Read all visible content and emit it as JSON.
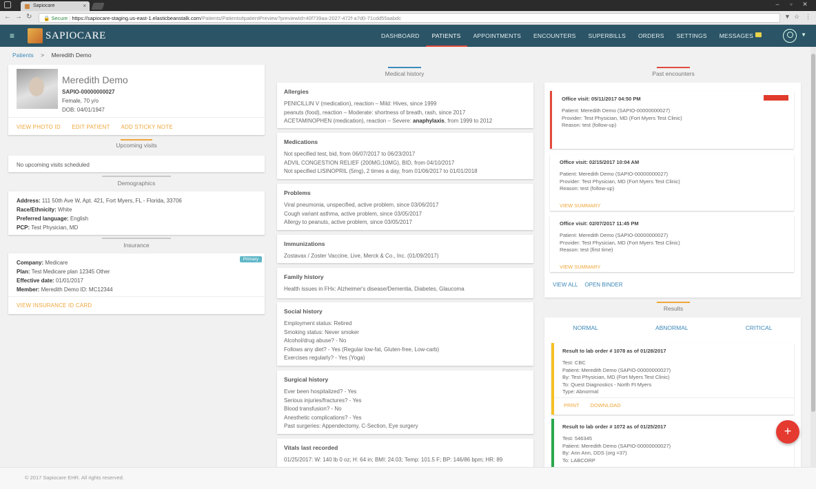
{
  "browser": {
    "tab_title": "Sapiocare",
    "secure_label": "Secure",
    "url_host": "https://sapiocare-staging.us-east-1.elasticbeanstalk.com",
    "url_path": "/Patients/Patients#patientPreview?previewId=40f739aa-2027-472f-a7d0-71cdd55aabdc"
  },
  "header": {
    "logo_text": "SAPIOCARE",
    "nav": [
      "DASHBOARD",
      "PATIENTS",
      "APPOINTMENTS",
      "ENCOUNTERS",
      "SUPERBILLS",
      "ORDERS",
      "SETTINGS",
      "MESSAGES"
    ],
    "active_nav": "PATIENTS"
  },
  "breadcrumb": {
    "root": "Patients",
    "separator": ">",
    "current": "Meredith Demo"
  },
  "patient": {
    "name": "Meredith Demo",
    "id": "SAPIO-00000000027",
    "sex_age": "Female, 70 y/o",
    "dob": "DOB: 04/01/1947",
    "actions": [
      "VIEW PHOTO ID",
      "EDIT PATIENT",
      "ADD STICKY NOTE"
    ]
  },
  "upcoming": {
    "title": "Upcoming visits",
    "empty": "No upcoming visits scheduled"
  },
  "demographics": {
    "title": "Demographics",
    "address_label": "Address:",
    "address": "111 50th Ave W, Apt. 421, Fort Myers, FL - Florida, 33706",
    "race_label": "Race/Ethnicity:",
    "race": "White",
    "language_label": "Preferred language:",
    "language": "English",
    "pcp_label": "PCP:",
    "pcp": "Test Physician, MD"
  },
  "insurance": {
    "title": "Insurance",
    "badge": "Primary",
    "company_label": "Company:",
    "company": "Medicare",
    "plan_label": "Plan:",
    "plan": "Test Medicare plan 12345 Other",
    "effective_label": "Effective date:",
    "effective": "01/01/2017",
    "member_label": "Member:",
    "member": "Meredith Demo ID: MC12344",
    "action": "VIEW INSURANCE ID CARD"
  },
  "medical_history": {
    "title": "Medical history",
    "sections": [
      {
        "title": "Allergies",
        "lines": [
          "PENICILLIN V (medication), reaction – Mild: Hives, since 1999",
          "peanuts (food), reaction – Moderate: shortness of breath, rash, since 2017",
          "ACETAMINOPHEN (medication), reaction – Severe: anaphylaxis, from 1999 to 2012"
        ]
      },
      {
        "title": "Medications",
        "lines": [
          "Not specified test, bid, from 06/07/2017 to 06/23/2017",
          "ADVIL CONGESTION RELIEF (200MG;10MG), BID, from 04/10/2017",
          "Not specified LISINOPRIL (5mg), 2 times a day, from 01/06/2017 to 01/01/2018"
        ]
      },
      {
        "title": "Problems",
        "lines": [
          "Viral pneumonia, unspecified, active problem, since 03/06/2017",
          "Cough variant asthma, active problem, since 03/05/2017",
          "Allergy to peanuts, active problem, since 03/05/2017"
        ]
      },
      {
        "title": "Immunizations",
        "lines": [
          "Zostavax / Zoster Vaccine, Live, Merck & Co., Inc. (01/09/2017)"
        ]
      },
      {
        "title": "Family history",
        "lines": [
          "Health issues in FHx: Alzheimer's disease/Dementia, Diabetes, Glaucoma"
        ]
      },
      {
        "title": "Social history",
        "lines": [
          "Employment status: Retired",
          "Smoking status: Never smoker",
          "Alcohol/drug abuse? - No",
          "Follows any diet? - Yes (Regular low-fat, Gluten-free, Low-carb)",
          "Exercises regularly? - Yes (Yoga)"
        ]
      },
      {
        "title": "Surgical history",
        "lines": [
          "Ever been hospitalized? - Yes",
          "Serious injuries/fractures? - Yes",
          "Blood transfusion? - No",
          "Anesthetic complications? - Yes",
          "Past surgeries: Appendectomy, C-Section, Eye surgery"
        ]
      },
      {
        "title": "Vitals last recorded",
        "lines": [
          "01/25/2017: W: 140 lb 0 oz; H: 64 in; BMI: 24.03; Temp: 101.5 F; BP: 146/86 bpm; HR: 89"
        ]
      }
    ]
  },
  "encounters": {
    "title": "Past encounters",
    "items": [
      {
        "title": "Office visit: 05/11/2017 04:50 PM",
        "patient": "Patient: Meredith Demo (SAPIO-00000000027)",
        "provider": "Provider: Test Physician, MD (Fort Myers Test Clinic)",
        "reason": "Reason: test (follow-up)",
        "link": ""
      },
      {
        "title": "Office visit: 02/15/2017 10:04 AM",
        "patient": "Patient: Meredith Demo (SAPIO-00000000027)",
        "provider": "Provider: Test Physician, MD (Fort Myers Test Clinic)",
        "reason": "Reason: test (follow-up)",
        "link": "VIEW SUMMARY"
      },
      {
        "title": "Office visit: 02/07/2017 11:45 PM",
        "patient": "Patient: Meredith Demo (SAPIO-00000000027)",
        "provider": "Provider: Test Physician, MD (Fort Myers Test Clinic)",
        "reason": "Reason: test (first time)",
        "link": "VIEW SUMMARY"
      }
    ],
    "view_all": "VIEW ALL",
    "open_binder": "OPEN BINDER"
  },
  "results": {
    "title": "Results",
    "tabs": [
      "NORMAL",
      "ABNORMAL",
      "CRITICAL"
    ],
    "items": [
      {
        "title": "Result to lab order # 1078 as of 01/28/2017",
        "lines": [
          "Test: CBC",
          "Patient: Meredith Demo (SAPIO-00000000027)",
          "By: Test Physician, MD (Fort Myers Test Clinic)",
          "To: Quest Diagnostics - North Ft Myers",
          "Type: Abnormal"
        ],
        "actions": [
          "PRINT",
          "DOWNLOAD"
        ],
        "color": "#f5c026"
      },
      {
        "title": "Result to lab order # 1072 as of 01/25/2017",
        "lines": [
          "Test: 546345",
          "Patient: Meredith Demo (SAPIO-00000000027)",
          "By: Ann Ann, DDS (org =37)",
          "To: LABCORP"
        ],
        "actions": [],
        "color": "#2aa84a"
      }
    ]
  },
  "fab": "+",
  "footer": "© 2017 Sapiocare EHR. All rights reserved.",
  "colors": {
    "header": "#2b5466",
    "accent": "#f0a63a",
    "link": "#3c88b8",
    "active": "#e24a3b"
  }
}
